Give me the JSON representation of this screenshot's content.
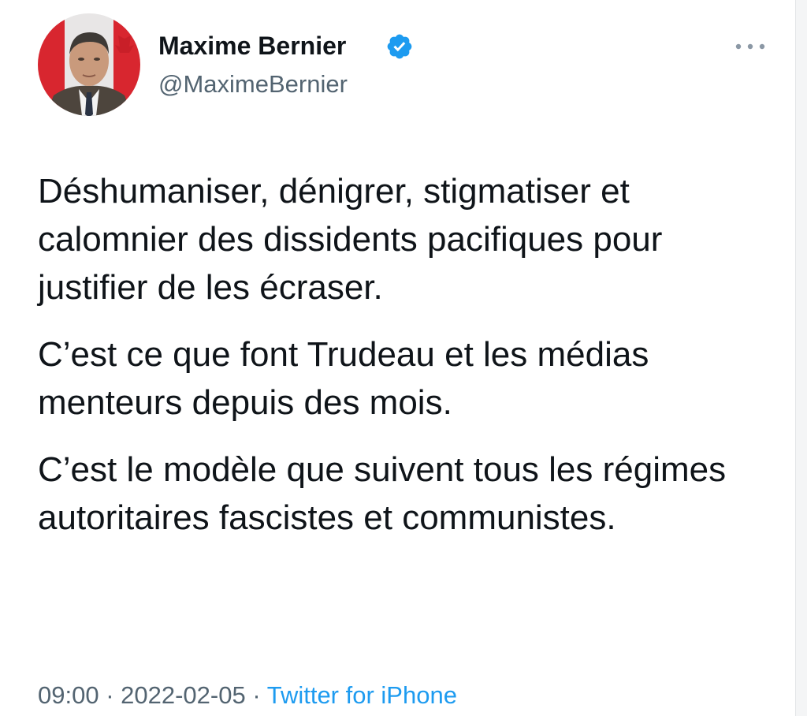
{
  "author": {
    "display_name": "Maxime Bernier",
    "handle": "@MaximeBernier",
    "verified": true,
    "verified_color": "#1d9bf0"
  },
  "more_icon": "ellipsis-icon",
  "tweet": {
    "paragraphs": [
      "Déshumaniser, dénigrer, stigmatiser et calomnier des dissidents pacifiques pour justifier de les écraser.",
      "C’est ce que font Trudeau et les médias menteurs depuis des mois.",
      "C’est le modèle que suivent tous les régimes autoritaires fascistes et communistes."
    ]
  },
  "meta": {
    "time": "09:00",
    "separator": " · ",
    "date": "2022-02-05",
    "source": "Twitter for iPhone"
  },
  "colors": {
    "text_primary": "#0f1419",
    "text_secondary": "#536471",
    "link": "#1d9bf0"
  }
}
